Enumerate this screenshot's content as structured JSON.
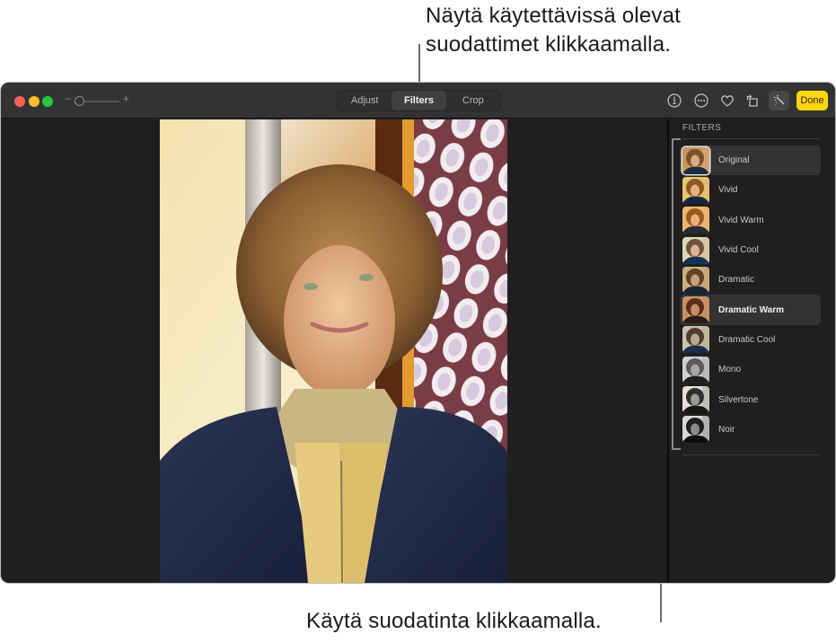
{
  "callouts": {
    "top_line1": "Näytä käytettävissä olevat",
    "top_line2": "suodattimet klikkaamalla.",
    "bottom": "Käytä suodatinta klikkaamalla."
  },
  "toolbar": {
    "zoom_minus": "−",
    "zoom_plus": "+",
    "zoom_level": 0,
    "tabs": [
      {
        "label": "Adjust",
        "active": false
      },
      {
        "label": "Filters",
        "active": true
      },
      {
        "label": "Crop",
        "active": false
      }
    ],
    "icons": [
      "info-icon",
      "more-icon",
      "heart-icon",
      "rotate-icon",
      "auto-enhance-icon"
    ],
    "done_label": "Done",
    "done_color": "#ffd60a"
  },
  "sidebar": {
    "title": "FILTERS",
    "filters": [
      {
        "label": "Original",
        "tone": "warm",
        "current": true,
        "highlighted": true
      },
      {
        "label": "Vivid",
        "tone": "vivid"
      },
      {
        "label": "Vivid Warm",
        "tone": "vividwarm"
      },
      {
        "label": "Vivid Cool",
        "tone": "vividcool"
      },
      {
        "label": "Dramatic",
        "tone": "dramatic"
      },
      {
        "label": "Dramatic Warm",
        "tone": "dramwarm",
        "selected": true
      },
      {
        "label": "Dramatic Cool",
        "tone": "dramcool"
      },
      {
        "label": "Mono",
        "tone": "mono"
      },
      {
        "label": "Silvertone",
        "tone": "silver"
      },
      {
        "label": "Noir",
        "tone": "noir"
      }
    ]
  },
  "photo": {
    "description": "Portrait of a young man with curly hair in front of a stained-glass window"
  }
}
